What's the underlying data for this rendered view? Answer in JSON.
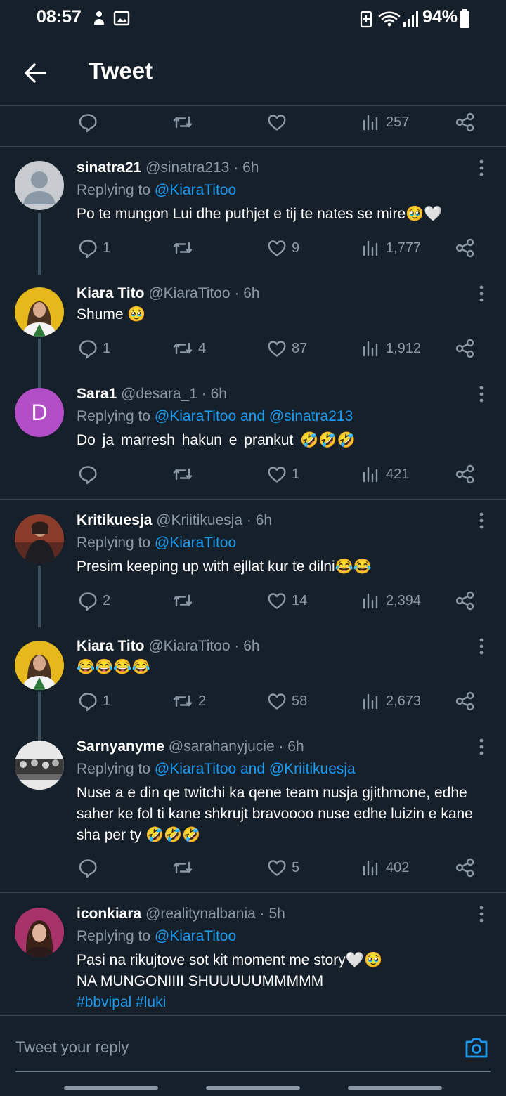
{
  "status_bar": {
    "time": "08:57",
    "battery": "94%",
    "icons": [
      "sync-icon",
      "gallery-icon",
      "battery-saver-icon",
      "wifi-icon",
      "signal-icon",
      "battery-icon"
    ]
  },
  "header": {
    "title": "Tweet",
    "back_icon": "arrow-left-icon"
  },
  "top_actions": {
    "views": "257"
  },
  "tweets": [
    {
      "name": "sinatra21",
      "meta": "@sinatra213 · 6h",
      "replying_prefix": "Replying to ",
      "replying_mentions": "@KiaraTitoo",
      "text": "Po te mungon Lui dhe puthjet e tij te nates se mire🥹🤍",
      "replies": "1",
      "retweets": "",
      "likes": "9",
      "views": "1,777",
      "avatar": "default-avatar"
    },
    {
      "name": "Kiara Tito",
      "meta": "@KiaraTitoo · 6h",
      "text": "Shume 🥹",
      "replies": "1",
      "retweets": "4",
      "likes": "87",
      "views": "1,912",
      "avatar": "photo-avatar"
    },
    {
      "name": "Sara1",
      "meta": "@desara_1 · 6h",
      "replying_prefix": "Replying to ",
      "replying_mentions": "@KiaraTitoo and @sinatra213",
      "text": "Do ja marresh hakun e prankut 🤣🤣🤣",
      "replies": "",
      "retweets": "",
      "likes": "1",
      "views": "421",
      "avatar": "letter-avatar",
      "avatar_letter": "D",
      "avatar_color": "#b34fc6"
    },
    {
      "name": "Kritikuesja",
      "meta": "@Kriitikuesja · 6h",
      "replying_prefix": "Replying to ",
      "replying_mentions": "@KiaraTitoo",
      "text": "Presim keeping up with ejllat  kur te dilni😂😂",
      "replies": "2",
      "retweets": "",
      "likes": "14",
      "views": "2,394",
      "avatar": "photo-avatar"
    },
    {
      "name": "Kiara Tito",
      "meta": "@KiaraTitoo · 6h",
      "text": "😂😂😂😂",
      "replies": "1",
      "retweets": "2",
      "likes": "58",
      "views": "2,673",
      "avatar": "photo-avatar"
    },
    {
      "name": "Sarnyanyme",
      "meta": "@sarahanyjucie · 6h",
      "replying_prefix": "Replying to ",
      "replying_mentions": "@KiaraTitoo and @Kriitikuesja",
      "text": "Nuse a e din qe twitchi ka qene team nusja gjithmone, edhe saher ke fol ti kane shkrujt bravoooo nuse edhe luizin e kane sha per ty 🤣🤣🤣",
      "replies": "",
      "retweets": "",
      "likes": "5",
      "views": "402",
      "avatar": "photo-avatar"
    },
    {
      "name": "iconkiara",
      "meta": "@realitynalbania · 5h",
      "replying_prefix": "Replying to ",
      "replying_mentions": "@KiaraTitoo",
      "text_line1": "Pasi na rikujtove sot kit moment me story🤍🥹",
      "text_line2": "NA MUNGONIIII SHUUUUUMMMMM",
      "text_tags": "#bbvipal #luki",
      "avatar": "photo-avatar"
    }
  ],
  "reply_bar": {
    "placeholder": "Tweet your reply",
    "camera_icon": "camera-icon"
  }
}
